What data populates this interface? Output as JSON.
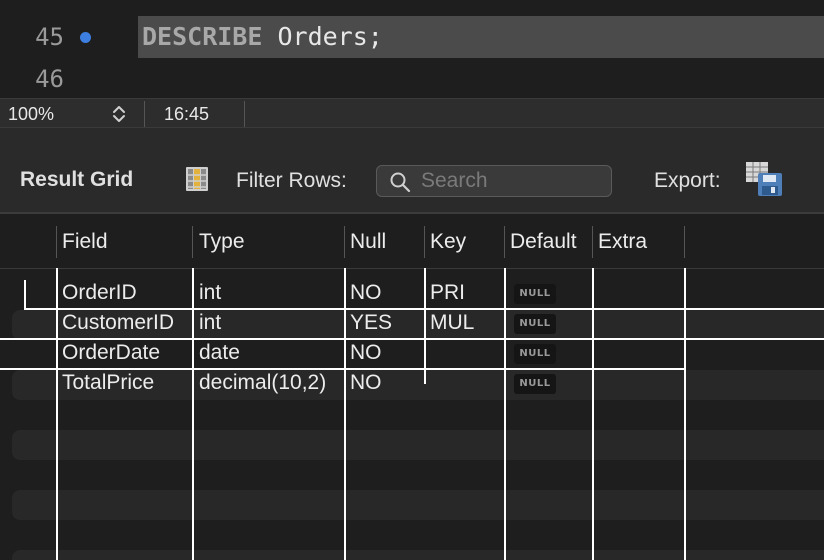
{
  "editor": {
    "lines": [
      {
        "number": "45",
        "keyword": "DESCRIBE",
        "text": " Orders;"
      },
      {
        "number": "46",
        "keyword": "",
        "text": ""
      }
    ]
  },
  "status": {
    "zoom": "100%",
    "cursor_position": "16:45"
  },
  "toolbar": {
    "result_grid_label": "Result Grid",
    "filter_rows_label": "Filter Rows:",
    "search_placeholder": "Search",
    "export_label": "Export:"
  },
  "grid": {
    "columns": [
      "Field",
      "Type",
      "Null",
      "Key",
      "Default",
      "Extra"
    ],
    "rows": [
      {
        "field": "OrderID",
        "type": "int",
        "null": "NO",
        "key": "PRI",
        "default": "NULL",
        "extra": ""
      },
      {
        "field": "CustomerID",
        "type": "int",
        "null": "YES",
        "key": "MUL",
        "default": "NULL",
        "extra": ""
      },
      {
        "field": "OrderDate",
        "type": "date",
        "null": "NO",
        "key": "",
        "default": "NULL",
        "extra": ""
      },
      {
        "field": "TotalPrice",
        "type": "decimal(10,2)",
        "null": "NO",
        "key": "",
        "default": "NULL",
        "extra": ""
      }
    ]
  },
  "colors": {
    "accent": "#3d7fe0",
    "line_highlight": "#4b4b4b",
    "background": "#1e1e1e"
  },
  "icons": [
    "breakpoint-marker-icon",
    "stepper-icon",
    "grid-icon",
    "search-icon",
    "export-icon"
  ]
}
